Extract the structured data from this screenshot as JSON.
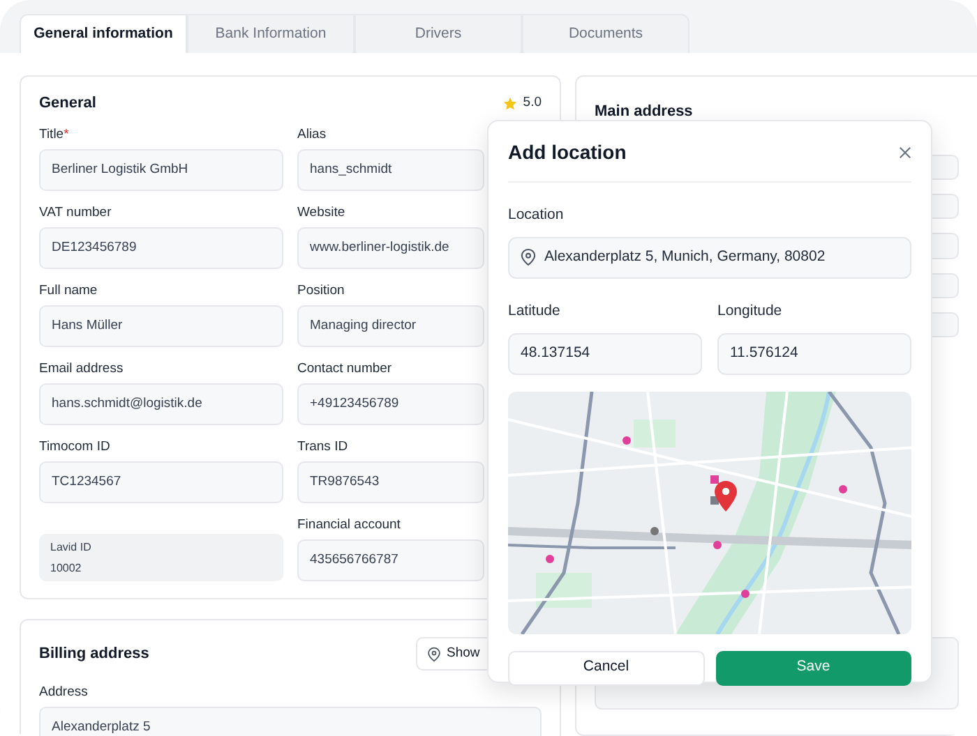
{
  "tabs": [
    {
      "label": "General information",
      "selected": true
    },
    {
      "label": "Bank Information",
      "selected": false
    },
    {
      "label": "Drivers",
      "selected": false
    },
    {
      "label": "Documents",
      "selected": false
    }
  ],
  "general": {
    "title": "General",
    "rating": "5.0",
    "fields": [
      {
        "kind": "input",
        "label": "Title",
        "marker": "*",
        "value": "Berliner Logistik GmbH"
      },
      {
        "kind": "input",
        "label": "Alias",
        "value": "hans_schmidt"
      },
      {
        "kind": "input",
        "label": "VAT number",
        "value": "DE123456789"
      },
      {
        "kind": "input",
        "label": "Website",
        "value": "www.berliner-logistik.de"
      },
      {
        "kind": "input",
        "label": "Full name",
        "value": "Hans Müller"
      },
      {
        "kind": "input",
        "label": "Position",
        "value": "Managing director"
      },
      {
        "kind": "input",
        "label": "Email address",
        "value": "hans.schmidt@logistik.de"
      },
      {
        "kind": "input",
        "label": "Contact number",
        "value": "+49123456789"
      },
      {
        "kind": "input",
        "label": "Timocom ID",
        "value": "TC1234567"
      },
      {
        "kind": "input",
        "label": "Trans ID",
        "value": "TR9876543"
      },
      {
        "kind": "readonly",
        "label": "Lavid ID",
        "value": "10002"
      },
      {
        "kind": "input",
        "label": "Financial account",
        "value": "435656766787"
      }
    ]
  },
  "main_address": {
    "title": "Main address"
  },
  "billing": {
    "title": "Billing address",
    "show_button": "Show",
    "fields": [
      {
        "label": "Address",
        "value": "Alexanderplatz 5"
      }
    ]
  },
  "modal": {
    "title": "Add location",
    "location": {
      "label": "Location",
      "value": "Alexanderplatz 5, Munich, Germany, 80802"
    },
    "latitude": {
      "label": "Latitude",
      "value": "48.137154"
    },
    "longitude": {
      "label": "Longitude",
      "value": "11.576124"
    },
    "buttons": [
      {
        "label": "Cancel",
        "kind": "secondary"
      },
      {
        "label": "Save",
        "kind": "primary"
      }
    ]
  }
}
